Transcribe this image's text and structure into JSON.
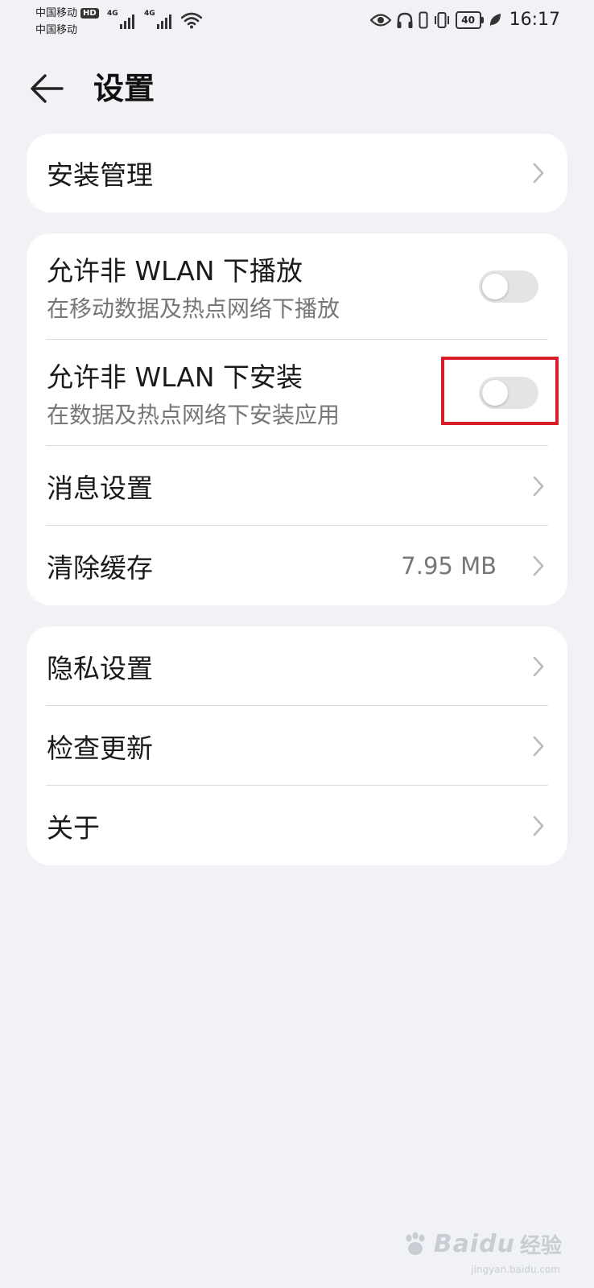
{
  "status_bar": {
    "carrier_1": "中国移动",
    "hd_badge": "HD",
    "carrier_2": "中国移动",
    "signal_1_label": "4G",
    "signal_2_label": "4G",
    "battery_level": "40",
    "time": "16:17"
  },
  "header": {
    "title": "设置"
  },
  "card_1": {
    "install_management": "安装管理"
  },
  "card_2": {
    "allow_play_title": "允许非 WLAN 下播放",
    "allow_play_sub": "在移动数据及热点网络下播放",
    "allow_play_on": false,
    "allow_install_title": "允许非 WLAN 下安装",
    "allow_install_sub": "在数据及热点网络下安装应用",
    "allow_install_on": false,
    "message_settings": "消息设置",
    "clear_cache": "清除缓存",
    "cache_size": "7.95 MB"
  },
  "card_3": {
    "privacy_settings": "隐私设置",
    "check_updates": "检查更新",
    "about": "关于"
  },
  "watermark": {
    "brand": "Baidu",
    "brand_cn": "经验",
    "url": "jingyan.baidu.com"
  },
  "colors": {
    "background": "#f1f2f5",
    "card": "#ffffff",
    "highlight": "#d81e2a",
    "switch_off": "#e4e4e4"
  }
}
